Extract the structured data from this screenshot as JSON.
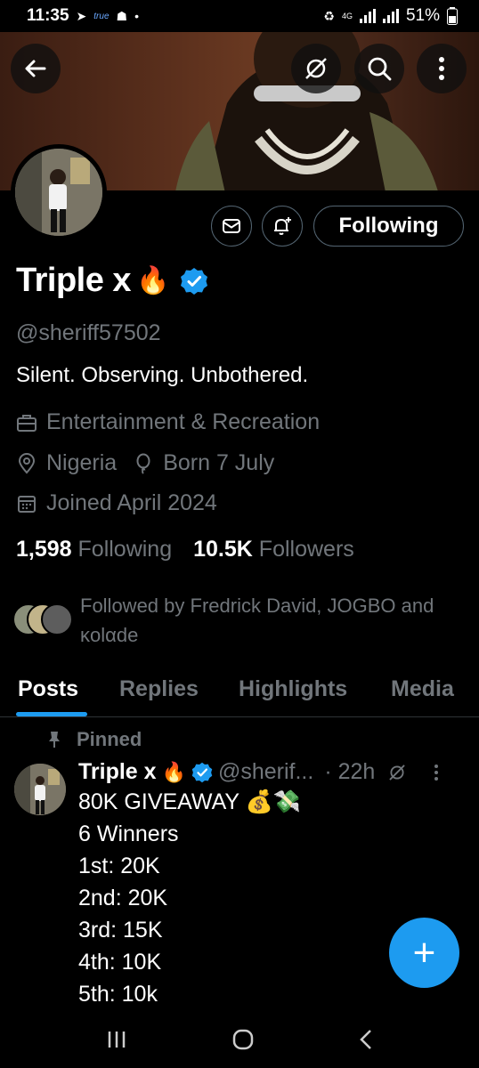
{
  "status_bar": {
    "time": "11:35",
    "carrier_tag": "true",
    "network": "4G",
    "battery": "51%",
    "icons": [
      "telegram-icon",
      "snapchat-icon",
      "dot-icon",
      "recycle-icon",
      "signal-icon",
      "signal-icon",
      "battery-icon"
    ]
  },
  "banner": {
    "buttons": [
      "back-arrow-icon",
      "grok-icon",
      "search-icon",
      "more-vertical-icon"
    ]
  },
  "profile": {
    "display_name": "Triple x",
    "name_emoji": "🔥",
    "verified": true,
    "handle": "@sheriff57502",
    "bio": "Silent. Observing. Unbothered.",
    "category": "Entertainment & Recreation",
    "location": "Nigeria",
    "birthday": "Born 7 July",
    "joined": "Joined April 2024",
    "following_count": "1,598",
    "following_label": "Following",
    "followers_count": "10.5K",
    "followers_label": "Followers",
    "followed_by": "Followed by Fredrick David, JOGBO and κolαde"
  },
  "actions": {
    "message_icon": "mail-icon",
    "notify_icon": "bell-plus-icon",
    "following_button": "Following"
  },
  "tabs": [
    {
      "label": "Posts",
      "active": true
    },
    {
      "label": "Replies",
      "active": false
    },
    {
      "label": "Highlights",
      "active": false
    },
    {
      "label": "Media",
      "active": false
    }
  ],
  "pinned_post": {
    "pinned_label": "Pinned",
    "author_name": "Triple x",
    "author_emoji": "🔥",
    "author_handle": "@sherif...",
    "time": "· 22h",
    "lines": [
      "80K GIVEAWAY 💰💸",
      "6 Winners",
      "1st: 20K",
      "2nd: 20K",
      "3rd: 15K",
      "4th: 10K",
      "5th: 10k"
    ]
  },
  "fab": {
    "label": "+"
  },
  "colors": {
    "accent": "#1d9bf0",
    "background": "#000000",
    "secondary_text": "#71767b",
    "border": "#2f3336"
  }
}
